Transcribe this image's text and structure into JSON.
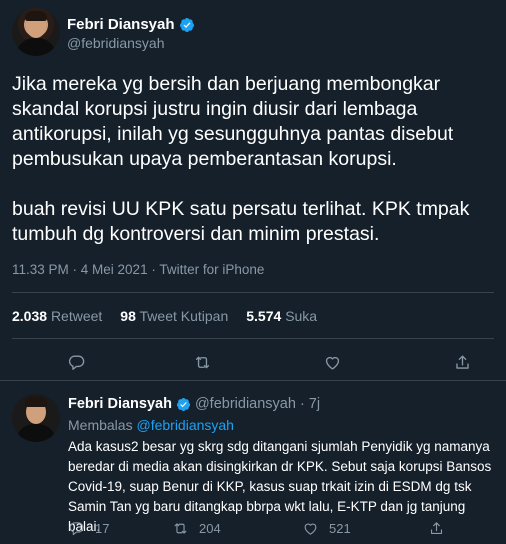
{
  "tweet": {
    "author": {
      "name": "Febri Diansyah",
      "handle": "@febridiansyah",
      "verified": true,
      "verified_color": "#1da1f2"
    },
    "text": [
      "Jika mereka yg bersih dan berjuang membongkar skandal korupsi justru ingin diusir dari lembaga antikorupsi, inilah yg sesungguhnya pantas disebut pembusukan upaya pemberantasan korupsi.",
      "buah revisi UU KPK satu persatu terlihat. KPK tmpak tumbuh dg kontroversi dan minim prestasi."
    ],
    "meta": "11.33 PM · 4 Mei 2021 · Twitter for iPhone",
    "stats": [
      {
        "count": "2.038",
        "label": "Retweet"
      },
      {
        "count": "98",
        "label": "Tweet Kutipan"
      },
      {
        "count": "5.574",
        "label": "Suka"
      }
    ],
    "actions": [
      "reply-icon",
      "retweet-icon",
      "like-icon",
      "share-icon"
    ]
  },
  "reply": {
    "author": {
      "name": "Febri Diansyah",
      "handle": "@febridiansyah",
      "time": "· 7j",
      "verified": true
    },
    "replying_label": "Membalas",
    "replying_to": "@febridiansyah",
    "text": "Ada kasus2 besar yg skrg sdg ditangani sjumlah Penyidik yg namanya beredar di media akan disingkirkan dr KPK. Sebut saja korupsi Bansos Covid-19, suap Benur di KKP, kasus suap trkait izin di ESDM dg tsk Samin Tan yg baru ditangkap bbrpa wkt lalu, E-KTP dan jg tanjung balai.",
    "actions": {
      "reply_count": "17",
      "retweet_count": "204",
      "like_count": "521"
    }
  },
  "colors": {
    "background": "#15202b",
    "text": "#ffffff",
    "muted": "#8899a6",
    "link": "#1da1f2",
    "divider": "#38444d"
  }
}
